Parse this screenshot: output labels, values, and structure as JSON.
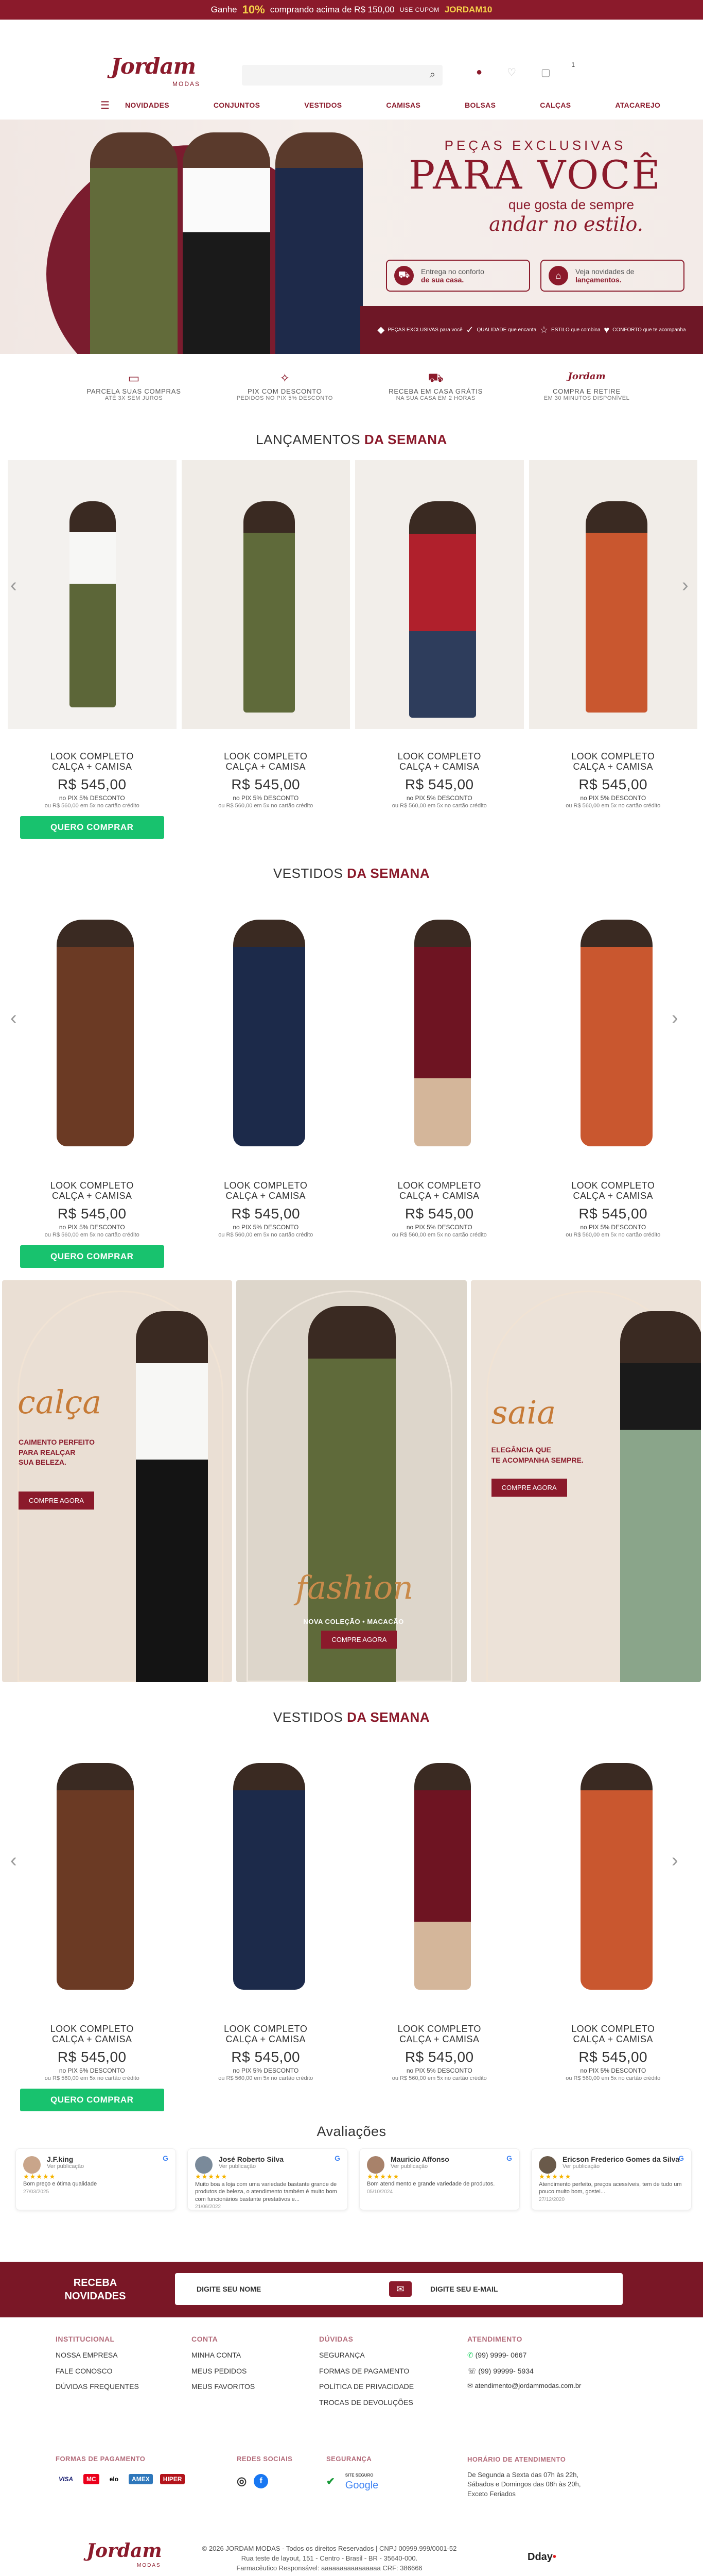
{
  "topbar": {
    "pre": "Ganhe",
    "pct": "10%",
    "mid": "comprando acima de R$ 150,00",
    "coupon_label": "USE CUPOM",
    "code": "JORDAM10"
  },
  "header": {
    "logo_main": "Jordam",
    "logo_sub": "MODAS",
    "cart_count": "1"
  },
  "nav": {
    "items": [
      "NOVIDADES",
      "CONJUNTOS",
      "VESTIDOS",
      "CAMISAS",
      "BOLSAS",
      "CALÇAS",
      "ATACAREJO"
    ]
  },
  "hero": {
    "kicker": "PEÇAS EXCLUSIVAS",
    "title": "PARA VOCÊ",
    "line1": "que gosta de sempre",
    "line2": "andar no estilo.",
    "box1": {
      "a": "Entrega no conforto",
      "b": "de sua casa."
    },
    "box2": {
      "a": "Veja novidades de",
      "b": "lançamentos."
    },
    "band": [
      "PEÇAS EXCLUSIVAS para você",
      "QUALIDADE que encanta",
      "ESTILO que combina",
      "CONFORTO que te acompanha"
    ]
  },
  "benefits": [
    {
      "t": "PARCELA SUAS COMPRAS",
      "s": "ATÉ 3X SEM JUROS"
    },
    {
      "t": "PIX COM DESCONTO",
      "s": "PEDIDOS NO PIX 5% DESCONTO"
    },
    {
      "t": "RECEBA EM CASA GRÁTIS",
      "s": "NA SUA CASA EM 2 HORAS"
    },
    {
      "t": "COMPRA E RETIRE",
      "s": "EM 30 MINUTOS DISPONÍVEL"
    }
  ],
  "benefit4_logo": "Jordam",
  "sections": {
    "s1": {
      "a": "LANÇAMENTOS",
      "b": "DA SEMANA"
    },
    "s2": {
      "a": "VESTIDOS",
      "b": "DA SEMANA"
    },
    "s3": {
      "a": "VESTIDOS",
      "b": "DA SEMANA"
    },
    "reviews": "Avaliações"
  },
  "product": {
    "t1": "LOOK COMPLETO",
    "t2": "CALÇA + CAMISA",
    "price": "R$ 545,00",
    "pix": "no PIX 5% DESCONTO",
    "inst": "ou R$ 560,00 em 5x no cartão crédito",
    "buy": "QUERO COMPRAR"
  },
  "banners": {
    "b1": {
      "word": "calça",
      "desc1": "CAIMENTO PERFEITO",
      "desc2": "PARA REALÇAR",
      "desc3": "SUA BELEZA.",
      "btn": "COMPRE AGORA"
    },
    "b2": {
      "word": "fashion",
      "sub": "NOVA COLEÇÃO • MACACÃO",
      "btn": "COMPRE AGORA"
    },
    "b3": {
      "word": "saia",
      "desc1": "ELEGÂNCIA QUE",
      "desc2": "TE ACOMPANHA SEMPRE.",
      "btn": "COMPRE AGORA"
    }
  },
  "reviews": [
    {
      "name": "J.F.king",
      "ver": "Ver publicação",
      "text": "Bom preço e ótima qualidade",
      "date": "27/03/2025"
    },
    {
      "name": "José Roberto Silva",
      "ver": "Ver publicação",
      "text": "Muito boa a loja com uma variedade bastante grande de produtos de beleza, o atendimento também é muito bom com funcionários bastante prestativos e...",
      "date": "21/06/2022"
    },
    {
      "name": "Mauricio Affonso",
      "ver": "Ver publicação",
      "text": "Bom atendimento e grande variedade de produtos.",
      "date": "05/10/2024"
    },
    {
      "name": "Ericson Frederico Gomes da Silva",
      "ver": "Ver publicação",
      "text": "Atendimento perfeito, preços acessíveis, tem de tudo um pouco muito bom, gostei...",
      "date": "27/12/2020"
    }
  ],
  "newsletter": {
    "label1": "RECEBA",
    "label2": "NOVIDADES",
    "name_ph": "DIGITE SEU NOME",
    "email_ph": "DIGITE SEU E-MAIL"
  },
  "footer": {
    "inst": {
      "h": "INSTITUCIONAL",
      "items": [
        "NOSSA EMPRESA",
        "FALE CONOSCO",
        "DÚVIDAS FREQUENTES"
      ]
    },
    "conta": {
      "h": "CONTA",
      "items": [
        "MINHA CONTA",
        "MEUS PEDIDOS",
        "MEUS FAVORITOS"
      ]
    },
    "duvidas": {
      "h": "DÚVIDAS",
      "items": [
        "SEGURANÇA",
        "FORMAS DE PAGAMENTO",
        "POLÍTICA DE PRIVACIDADE",
        "TROCAS DE DEVOLUÇÕES"
      ]
    },
    "atendimento": {
      "h": "ATENDIMENTO",
      "phone1": "(99) 9999- 0667",
      "phone2": "(99) 99999- 5934",
      "email": "atendimento@jordammodas.com.br"
    },
    "pay_h": "FORMAS DE PAGAMENTO",
    "pay": [
      "VISA",
      "MC",
      "elo",
      "AMEX",
      "HIPER"
    ],
    "social_h": "REDES SOCIAIS",
    "sec_h": "SEGURANÇA",
    "sec_badge": "Google",
    "sec_badge_top": "SITE SEGURO",
    "hours_h": "HORÁRIO DE ATENDIMENTO",
    "hours1": "De Segunda a Sexta das 07h às 22h,",
    "hours2": "Sábados e Domingos das 08h às 20h,",
    "hours3": "Exceto Feriados"
  },
  "bottom": {
    "logo": "Jordam",
    "logo_sub": "MODAS",
    "l1": "© 2026 JORDAM MODAS - Todos os direitos Reservados | CNPJ 00999.999/0001-52",
    "l2": "Rua teste de layout, 151 - Centro - Brasil - BR - 35640-000.",
    "l3": "Farmacêutico Responsável: aaaaaaaaaaaaaaaa CRF: 386666",
    "dev": "Dday"
  }
}
